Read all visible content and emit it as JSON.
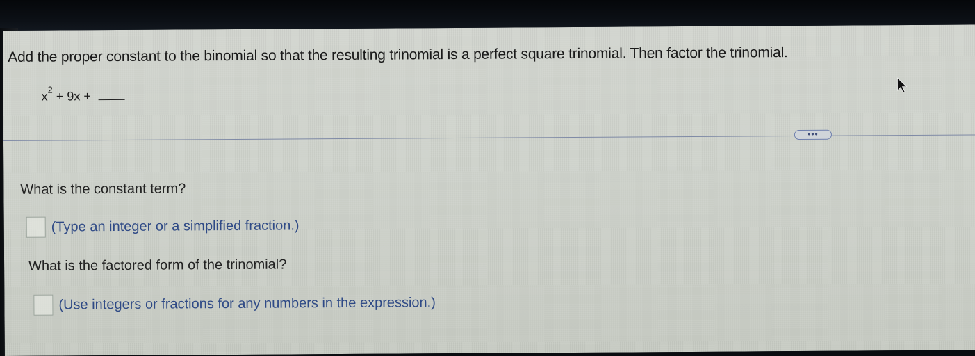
{
  "question": {
    "instruction": "Add the proper constant to the binomial so that the resulting trinomial is a perfect square trinomial. Then factor the trinomial.",
    "expression": {
      "base": "x",
      "exponent": "2",
      "rest": " + 9x + "
    }
  },
  "toolbar": {
    "more_label": "•••"
  },
  "parts": [
    {
      "prompt": "What is the constant term?",
      "hint": "(Type an integer or a simplified fraction.)"
    },
    {
      "prompt": "What is the factored form of the trinomial?",
      "hint": "(Use integers or fractions for any numbers in the expression.)"
    }
  ],
  "colors": {
    "hint_text": "#2f4a86",
    "divider": "#7f8aa6",
    "background": "#cfd3cc"
  },
  "icons": {
    "cursor": "mouse-pointer-icon"
  }
}
